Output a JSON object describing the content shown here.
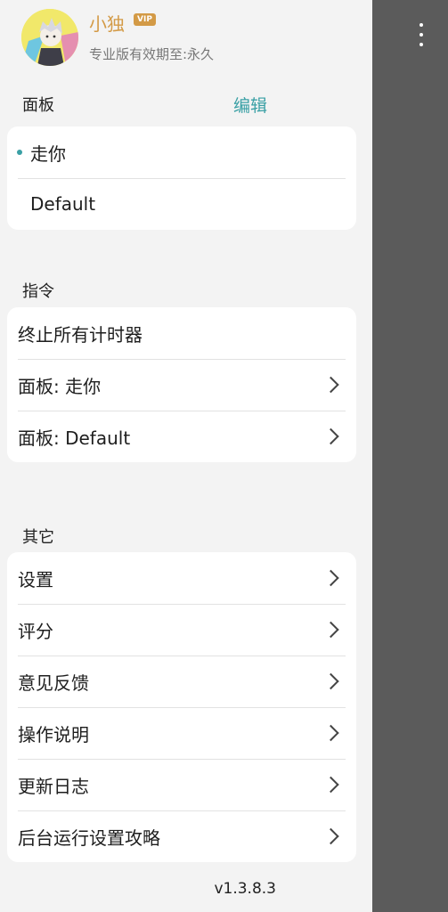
{
  "profile": {
    "name": "小独",
    "badge": "VIP",
    "subscription": "专业版有效期至:永久"
  },
  "panels": {
    "title": "面板",
    "edit_label": "编辑",
    "items": [
      {
        "label": "走你",
        "active": true
      },
      {
        "label": "Default",
        "active": false
      }
    ]
  },
  "commands": {
    "title": "指令",
    "items": [
      {
        "label": "终止所有计时器",
        "chevron": false
      },
      {
        "label": "面板: 走你",
        "chevron": true
      },
      {
        "label": "面板: Default",
        "chevron": true
      }
    ]
  },
  "others": {
    "title": "其它",
    "items": [
      {
        "label": "设置"
      },
      {
        "label": "评分"
      },
      {
        "label": "意见反馈"
      },
      {
        "label": "操作说明"
      },
      {
        "label": "更新日志"
      },
      {
        "label": "后台运行设置攻略"
      }
    ]
  },
  "version": "v1.3.8.3",
  "colors": {
    "accent": "#3aa0a5",
    "vip": "#d39a46",
    "scrim": "#5b5b5b"
  },
  "icons": {
    "overflow": "more-vertical-icon",
    "chevron": "chevron-right-icon",
    "active_marker": "dot-icon"
  }
}
